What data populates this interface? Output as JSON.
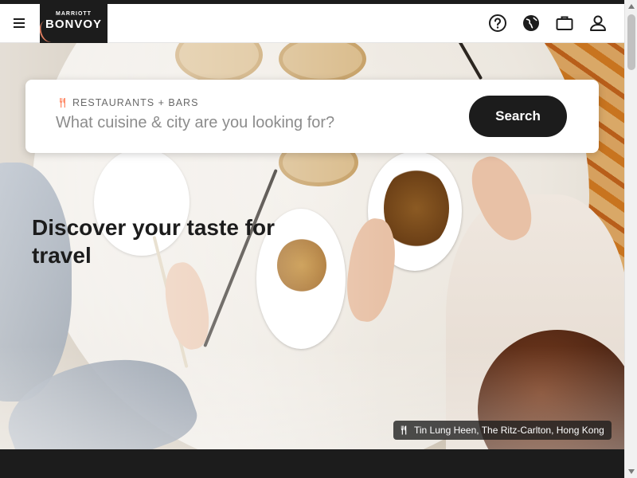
{
  "header": {
    "logo_line1": "MARRIOTT",
    "logo_line2": "BONVOY",
    "icons": [
      "menu-icon",
      "help-icon",
      "globe-icon",
      "briefcase-icon",
      "account-icon"
    ]
  },
  "search": {
    "category_label": "RESTAURANTS + BARS",
    "placeholder": "What cuisine & city are you looking for?",
    "button_label": "Search"
  },
  "hero": {
    "headline": "Discover your taste for travel",
    "caption": "Tin Lung Heen, The Ritz-Carlton, Hong Kong"
  },
  "colors": {
    "brand_dark": "#1c1c1c",
    "accent": "#ff8d6b",
    "white": "#ffffff"
  }
}
